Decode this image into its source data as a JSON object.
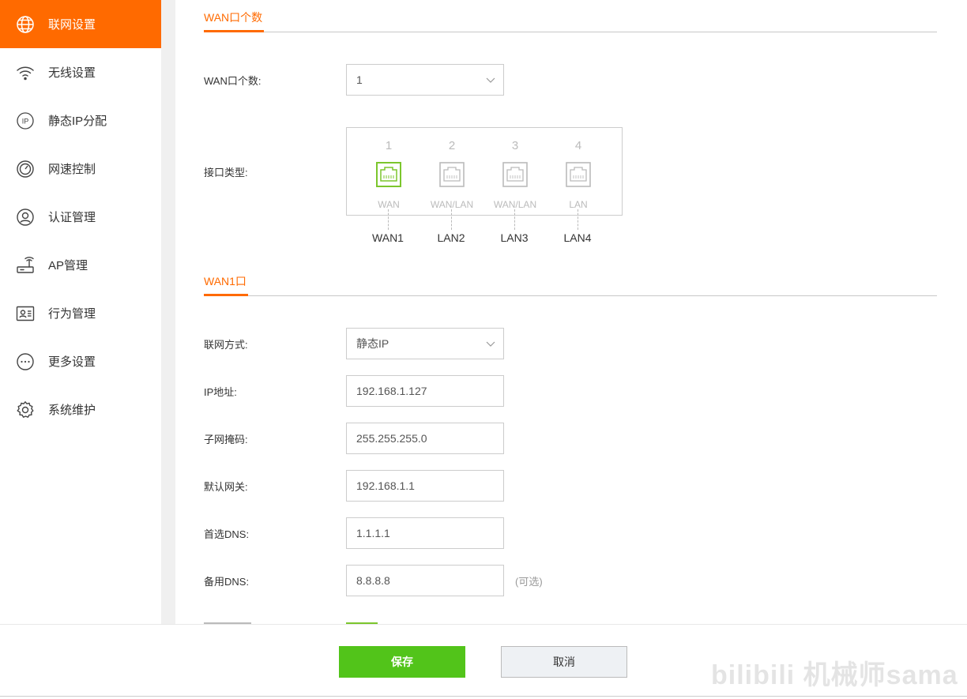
{
  "sidebar": {
    "items": [
      {
        "label": "联网设置",
        "icon": "globe-icon"
      },
      {
        "label": "无线设置",
        "icon": "wifi-icon"
      },
      {
        "label": "静态IP分配",
        "icon": "ip-icon"
      },
      {
        "label": "网速控制",
        "icon": "speedometer-icon"
      },
      {
        "label": "认证管理",
        "icon": "user-auth-icon"
      },
      {
        "label": "AP管理",
        "icon": "access-point-icon"
      },
      {
        "label": "行为管理",
        "icon": "id-card-icon"
      },
      {
        "label": "更多设置",
        "icon": "more-icon"
      },
      {
        "label": "系统维护",
        "icon": "gear-icon"
      }
    ],
    "active_index": 0
  },
  "wan_count_section": {
    "title": "WAN口个数",
    "count_label": "WAN口个数:",
    "count_value": "1",
    "port_type_label": "接口类型:"
  },
  "ports": [
    {
      "number": "1",
      "type": "WAN",
      "name": "WAN1",
      "active": true
    },
    {
      "number": "2",
      "type": "WAN/LAN",
      "name": "LAN2",
      "active": false
    },
    {
      "number": "3",
      "type": "WAN/LAN",
      "name": "LAN3",
      "active": false
    },
    {
      "number": "4",
      "type": "LAN",
      "name": "LAN4",
      "active": false
    }
  ],
  "wan1_section": {
    "title": "WAN1口",
    "connection_mode": {
      "label": "联网方式:",
      "value": "静态IP"
    },
    "ip_address": {
      "label": "IP地址:",
      "value": "192.168.1.127"
    },
    "subnet_mask": {
      "label": "子网掩码:",
      "value": "255.255.255.0"
    },
    "gateway": {
      "label": "默认网关:",
      "value": "192.168.1.1"
    },
    "primary_dns": {
      "label": "首选DNS:",
      "value": "1.1.1.1"
    },
    "secondary_dns": {
      "label": "备用DNS:",
      "value": "8.8.8.8",
      "hint": "(可选)"
    }
  },
  "footer": {
    "save_label": "保存",
    "cancel_label": "取消",
    "watermark": "bilibili 机械师sama"
  },
  "colors": {
    "accent": "#ff6a00",
    "save": "#52c41a",
    "active_port": "#7cc62d"
  }
}
